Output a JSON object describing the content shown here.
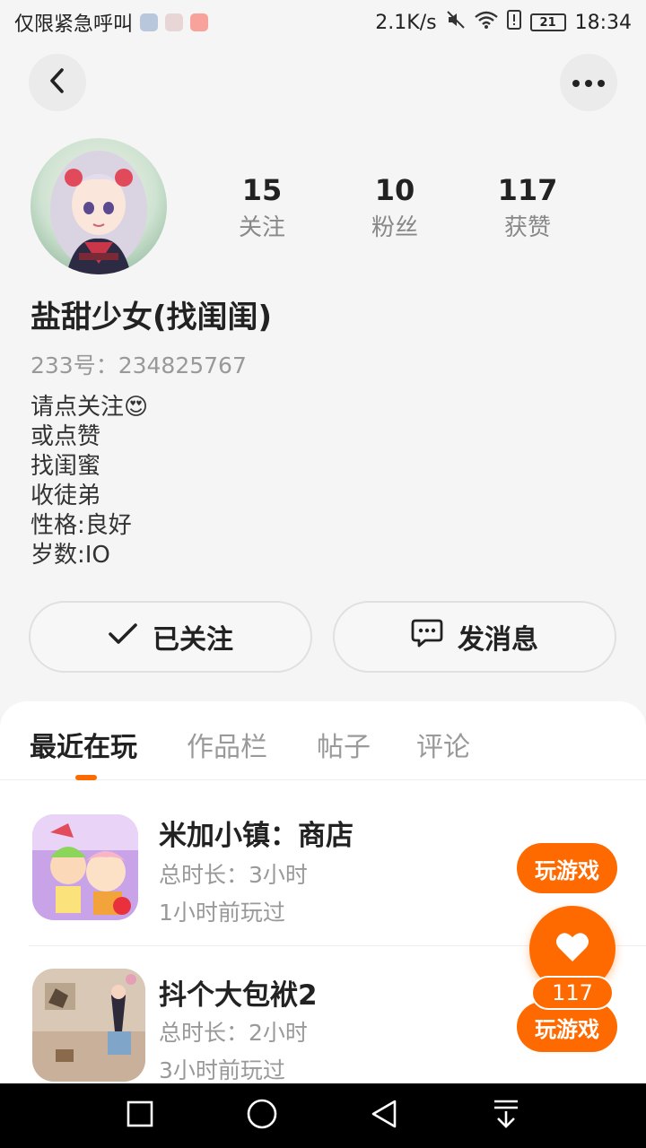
{
  "status_bar": {
    "carrier": "仅限紧急呼叫",
    "speed": "2.1K/s",
    "battery": "21",
    "time": "18:34"
  },
  "icons": {
    "back": "chevron-left-icon",
    "more": "more-horizontal-icon",
    "follow": "check-icon",
    "message": "chat-bubble-icon",
    "like": "heart-icon"
  },
  "profile": {
    "stats": [
      {
        "value": "15",
        "label": "关注"
      },
      {
        "value": "10",
        "label": "粉丝"
      },
      {
        "value": "117",
        "label": "获赞"
      }
    ],
    "username": "盐甜少女(找闺闺)",
    "uid": "233号：234825767",
    "bio": [
      "请点关注😍",
      "或点赞",
      "找闺蜜",
      "收徒弟",
      "性格:良好",
      "岁数:IO"
    ]
  },
  "actions": {
    "follow_label": "已关注",
    "message_label": "发消息"
  },
  "tabs": [
    "最近在玩",
    "作品栏",
    "帖子",
    "评论"
  ],
  "games": [
    {
      "title": "米加小镇：商店",
      "duration": "总时长：3小时",
      "last_played": "1小时前玩过",
      "button": "玩游戏"
    },
    {
      "title": "抖个大包袱2",
      "duration": "总时长：2小时",
      "last_played": "3小时前玩过",
      "button": "玩游戏"
    }
  ],
  "like_fab": {
    "count": "117"
  },
  "colors": {
    "accent": "#ff6a00",
    "background": "#f5f5f5",
    "muted_text": "#999999"
  }
}
